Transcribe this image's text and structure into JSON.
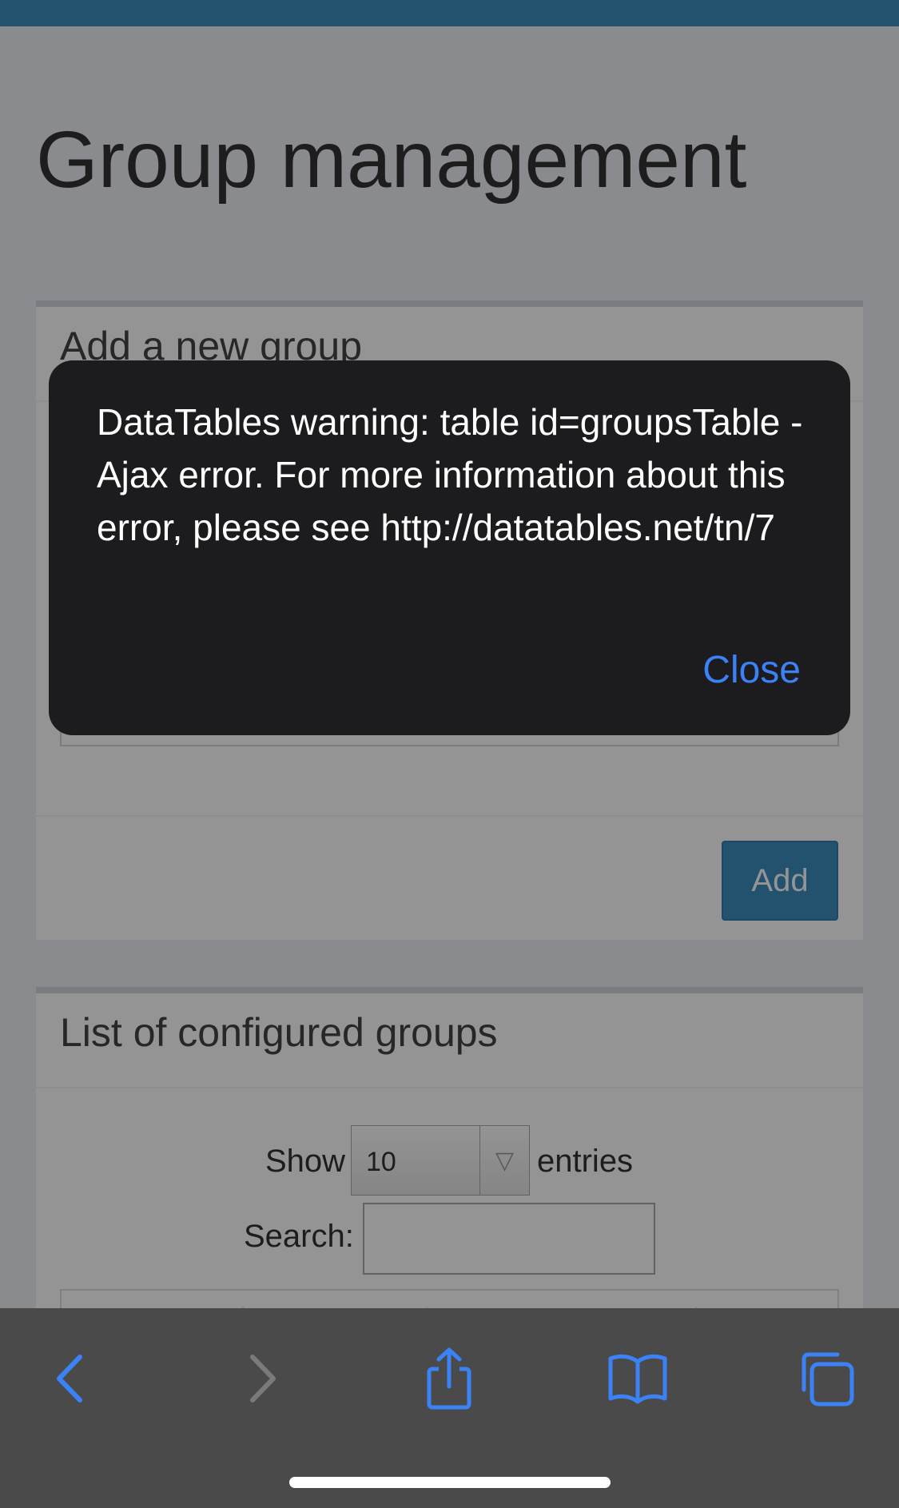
{
  "page": {
    "title": "Group management"
  },
  "add_box": {
    "title": "Add a new group",
    "add_label": "Add"
  },
  "list_box": {
    "title": "List of configured groups",
    "show_label": "Show",
    "page_length": "10",
    "entries_label": "entries",
    "search_label": "Search:"
  },
  "alert": {
    "message": "DataTables warning: table id=groupsTable - Ajax error. For more information about this error, please see http://datatables.net/tn/7",
    "close_label": "Close"
  },
  "toolbar": {
    "icons": [
      "back-icon",
      "forward-icon",
      "share-icon",
      "bookmarks-icon",
      "tabs-icon"
    ]
  },
  "colors": {
    "accent": "#3c8dbc",
    "dialog_bg": "#1c1c1e",
    "dialog_link": "#3b82f6",
    "toolbar_bg": "#4a4a4a"
  }
}
